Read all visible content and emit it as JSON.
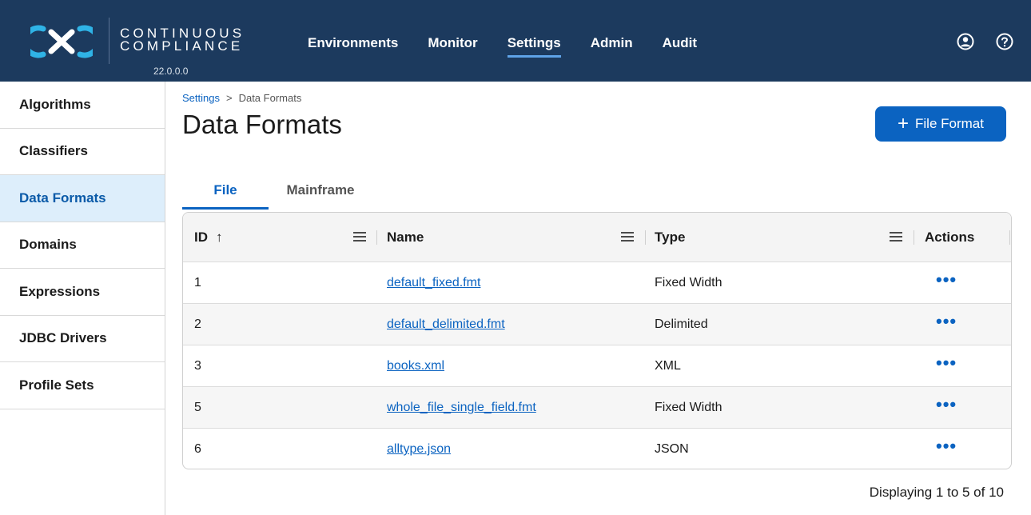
{
  "brand": {
    "line1": "CONTINUOUS",
    "line2": "COMPLIANCE",
    "version": "22.0.0.0",
    "logo_icon": "cx-logo-icon"
  },
  "nav": {
    "items": [
      {
        "label": "Environments"
      },
      {
        "label": "Monitor"
      },
      {
        "label": "Settings",
        "active": true
      },
      {
        "label": "Admin"
      },
      {
        "label": "Audit"
      }
    ],
    "user_icon": "user-icon",
    "help_icon": "help-icon"
  },
  "sidebar": {
    "items": [
      {
        "label": "Algorithms"
      },
      {
        "label": "Classifiers"
      },
      {
        "label": "Data Formats",
        "active": true
      },
      {
        "label": "Domains"
      },
      {
        "label": "Expressions"
      },
      {
        "label": "JDBC Drivers"
      },
      {
        "label": "Profile Sets"
      }
    ]
  },
  "breadcrumb": {
    "parent": "Settings",
    "separator": ">",
    "current": "Data Formats"
  },
  "page": {
    "title": "Data Formats",
    "add_button_label": "File Format"
  },
  "tabs": [
    {
      "label": "File",
      "active": true
    },
    {
      "label": "Mainframe"
    }
  ],
  "table": {
    "columns": {
      "id": "ID",
      "id_sort": "↑",
      "name": "Name",
      "type": "Type",
      "actions": "Actions"
    },
    "rows": [
      {
        "id": "1",
        "name": "default_fixed.fmt",
        "type": "Fixed Width",
        "actions": "•••"
      },
      {
        "id": "2",
        "name": "default_delimited.fmt",
        "type": "Delimited",
        "actions": "•••"
      },
      {
        "id": "3",
        "name": "books.xml",
        "type": "XML",
        "actions": "•••"
      },
      {
        "id": "5",
        "name": "whole_file_single_field.fmt",
        "type": "Fixed Width",
        "actions": "•••"
      },
      {
        "id": "6",
        "name": "alltype.json",
        "type": "JSON",
        "actions": "•••"
      }
    ]
  },
  "pagination": {
    "text": "Displaying 1 to 5 of 10"
  },
  "colors": {
    "header_bg": "#1c3a5e",
    "accent": "#0b63c1",
    "sidebar_active_bg": "#ddeefb"
  }
}
